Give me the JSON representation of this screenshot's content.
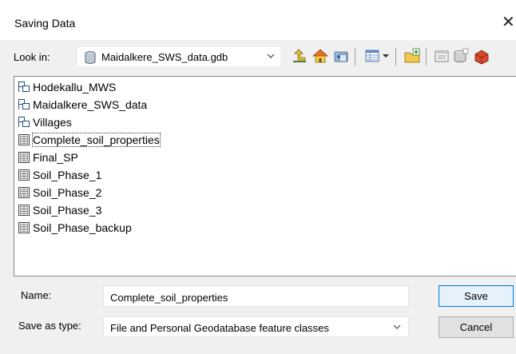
{
  "dialog": {
    "title": "Saving Data",
    "close_glyph": "✕"
  },
  "look_in": {
    "label": "Look in:",
    "value": "Maidalkere_SWS_data.gdb",
    "icon": "database-icon"
  },
  "toolbar": {
    "buttons": [
      "up-one-level-icon",
      "home-icon",
      "connect-folder-icon",
      "view-menu-icon",
      "new-folder-icon",
      "catalog-icon",
      "new-database-icon",
      "toolbox-icon"
    ]
  },
  "items": [
    {
      "label": "Hodekallu_MWS",
      "type": "dataset"
    },
    {
      "label": "Maidalkere_SWS_data",
      "type": "dataset"
    },
    {
      "label": "Villages",
      "type": "dataset"
    },
    {
      "label": "Complete_soil_properties",
      "type": "table",
      "selected": true
    },
    {
      "label": "Final_SP",
      "type": "table"
    },
    {
      "label": "Soil_Phase_1",
      "type": "table"
    },
    {
      "label": "Soil_Phase_2",
      "type": "table"
    },
    {
      "label": "Soil_Phase_3",
      "type": "table"
    },
    {
      "label": "Soil_Phase_backup",
      "type": "table"
    }
  ],
  "form": {
    "name_label": "Name:",
    "name_value": "Complete_soil_properties",
    "type_label": "Save as type:",
    "type_value": "File and Personal Geodatabase feature classes"
  },
  "buttons": {
    "save": "Save",
    "cancel": "Cancel"
  }
}
